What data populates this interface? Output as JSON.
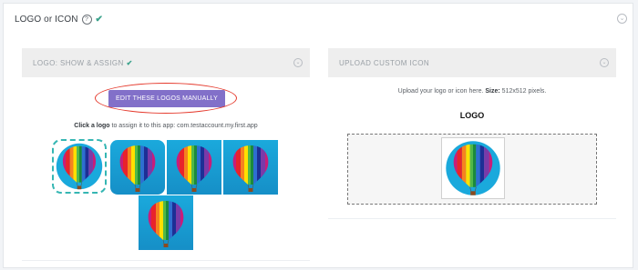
{
  "section": {
    "title": "LOGO or ICON",
    "help_glyph": "?",
    "done_glyph": "✔",
    "collapse_glyph": "⌄"
  },
  "left_panel": {
    "header": "LOGO: SHOW & ASSIGN",
    "header_check": "✔",
    "edit_button": "EDIT THESE LOGOS MANUALLY",
    "hint_prefix": "Click a logo",
    "hint_suffix": " to assign it to this app: com.testaccount.my.first.app",
    "logos": [
      {
        "style": "circle",
        "selected": true,
        "icon": "hot-air-balloon"
      },
      {
        "style": "rounded",
        "selected": false,
        "icon": "hot-air-balloon"
      },
      {
        "style": "square",
        "selected": false,
        "icon": "hot-air-balloon"
      },
      {
        "style": "square",
        "selected": false,
        "icon": "hot-air-balloon"
      },
      {
        "style": "square",
        "selected": false,
        "icon": "hot-air-balloon"
      }
    ]
  },
  "right_panel": {
    "header": "UPLOAD CUSTOM ICON",
    "upload_prefix": "Upload your logo or icon here. ",
    "size_label": "Size:",
    "size_value": " 512x512 pixels.",
    "logo_title": "LOGO"
  },
  "colors": {
    "accent_button": "#8270c9",
    "highlight_oval": "#e53a2d",
    "check": "#3aa28b",
    "selected_border": "#35b6b3",
    "balloon_bg": "#1aa9dc"
  }
}
